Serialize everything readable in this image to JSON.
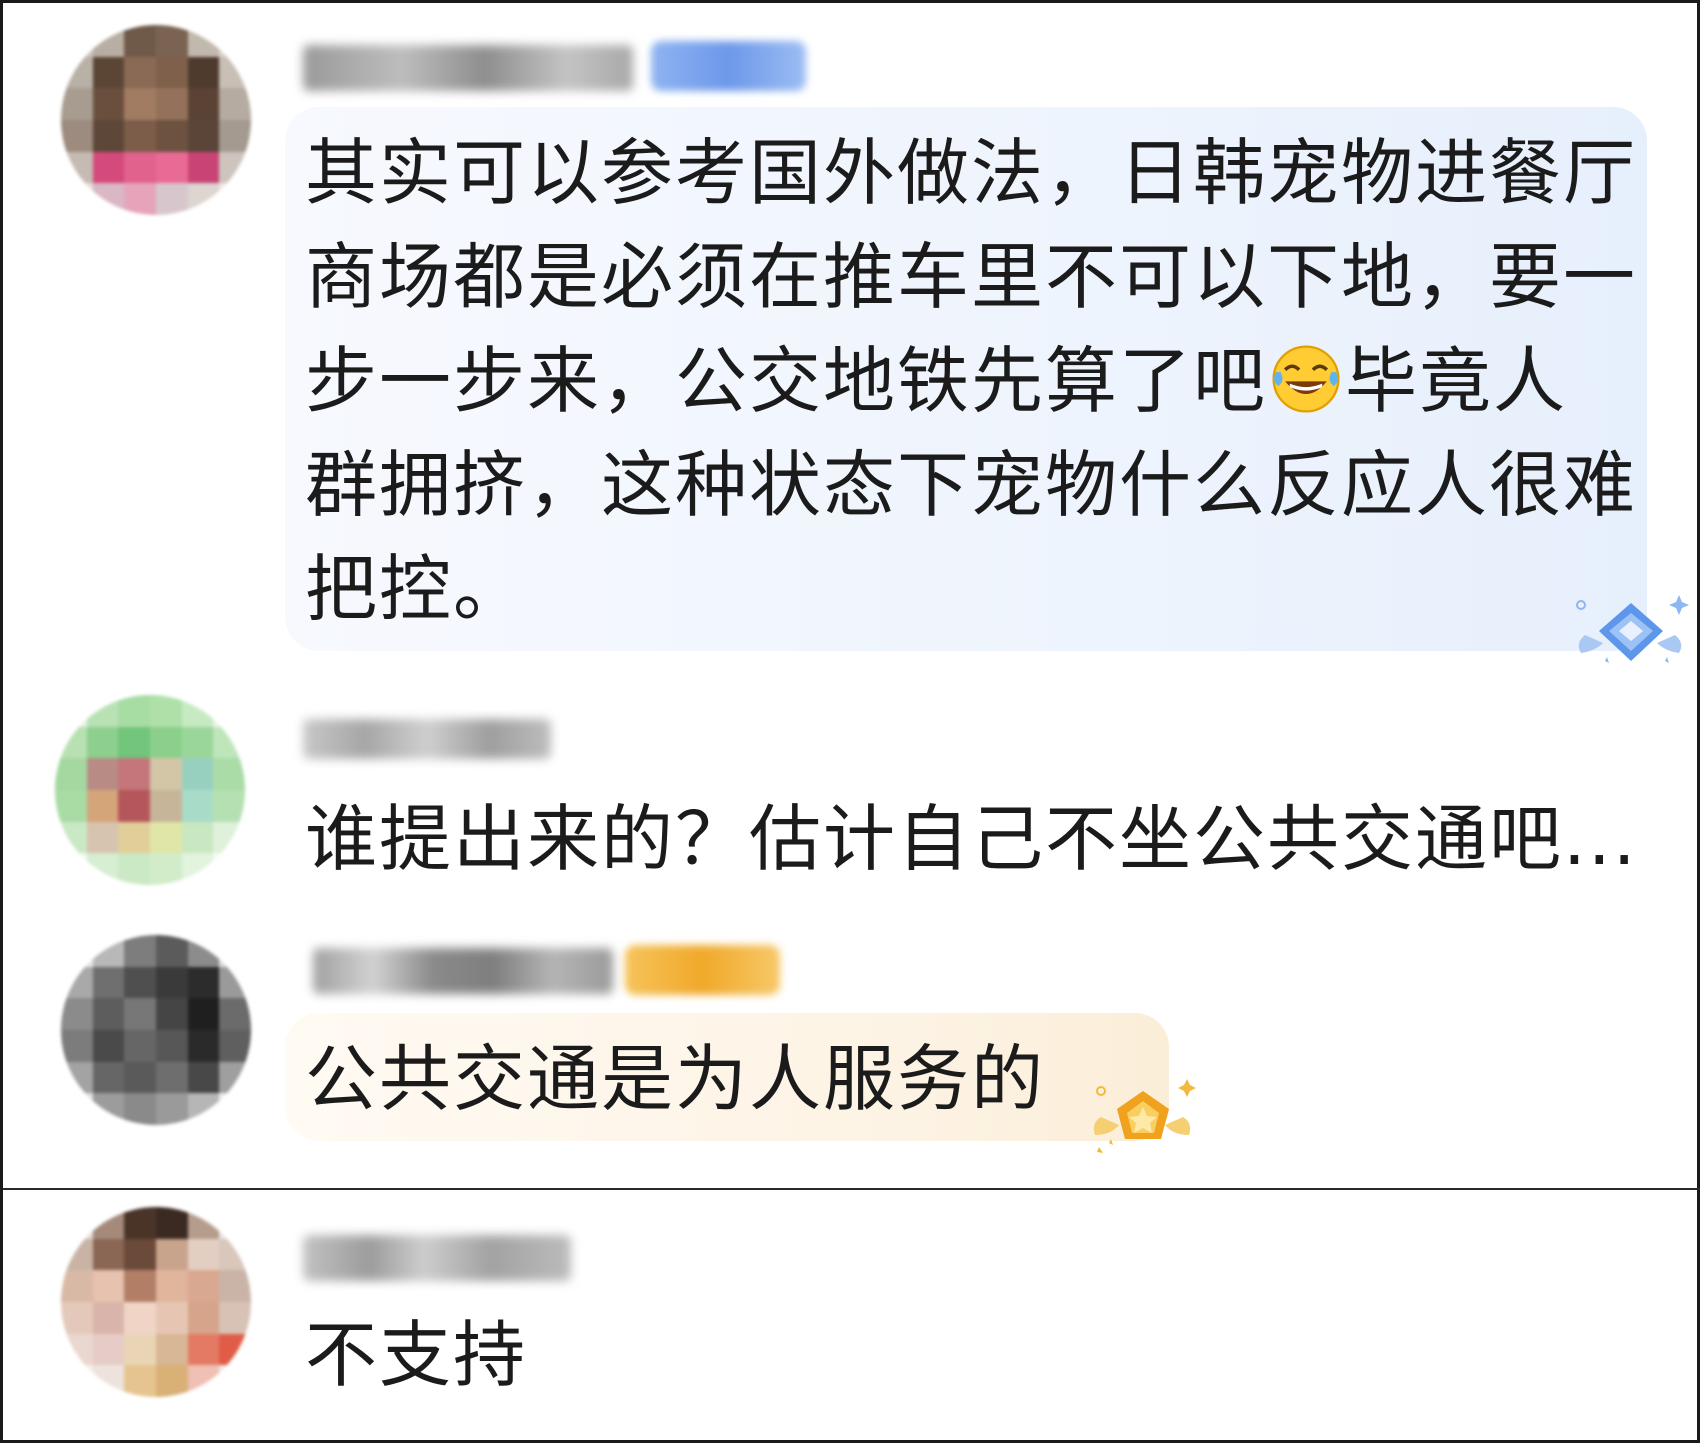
{
  "comments": [
    {
      "text_lines": [
        "其实可以参考国外做法，日韩宠物进餐厅",
        "商场都是必须在推车里不可以下地，要一",
        "步一步来，公交地铁先算了吧"
      ],
      "text_after_emoji_line3": "毕竟人",
      "text_line4": "群拥挤，这种状态下宠物什么反应人很难",
      "text_line5": "把控。",
      "emoji": "laughing-tears-emoji",
      "badge_icon": "diamond-badge-icon",
      "bubble_color": "#edf3fd"
    },
    {
      "text": "谁提出来的？估计自己不坐公共交通吧..."
    },
    {
      "text": "公共交通是为人服务的",
      "badge_icon": "gold-star-badge-icon",
      "bubble_color": "#fdf5e8"
    },
    {
      "text": "不支持"
    }
  ]
}
